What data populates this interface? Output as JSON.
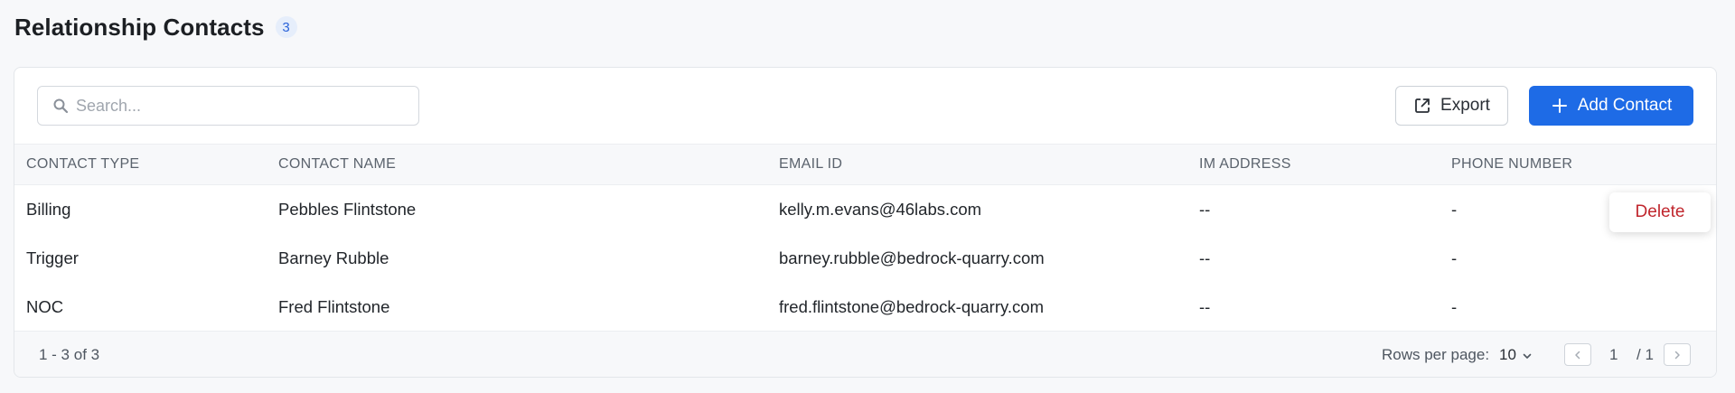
{
  "header": {
    "title": "Relationship Contacts",
    "count": "3"
  },
  "toolbar": {
    "search_placeholder": "Search...",
    "export_label": "Export",
    "add_label": "Add Contact",
    "accent_color": "#1e6be6"
  },
  "table": {
    "columns": [
      "CONTACT TYPE",
      "CONTACT NAME",
      "EMAIL ID",
      "IM ADDRESS",
      "PHONE NUMBER"
    ],
    "rows": [
      {
        "type": "Billing",
        "name": "Pebbles Flintstone",
        "email": "kelly.m.evans@46labs.com",
        "im": "--",
        "phone": "-"
      },
      {
        "type": "Trigger",
        "name": "Barney Rubble",
        "email": "barney.rubble@bedrock-quarry.com",
        "im": "--",
        "phone": "-"
      },
      {
        "type": "NOC",
        "name": "Fred Flintstone",
        "email": "fred.flintstone@bedrock-quarry.com",
        "im": "--",
        "phone": "-"
      }
    ]
  },
  "row_menu": {
    "delete_label": "Delete",
    "danger_color": "#c0262d"
  },
  "footer": {
    "range": "1 - 3 of 3",
    "rows_per_page_label": "Rows per page:",
    "rows_per_page_value": "10",
    "current_page": "1",
    "total_pages": "/ 1"
  },
  "icons": {
    "search": "search-icon",
    "export": "external-link-icon",
    "add": "plus-icon",
    "rows_dropdown": "chevron-down-icon",
    "prev": "chevron-left-icon",
    "next": "chevron-right-icon"
  }
}
